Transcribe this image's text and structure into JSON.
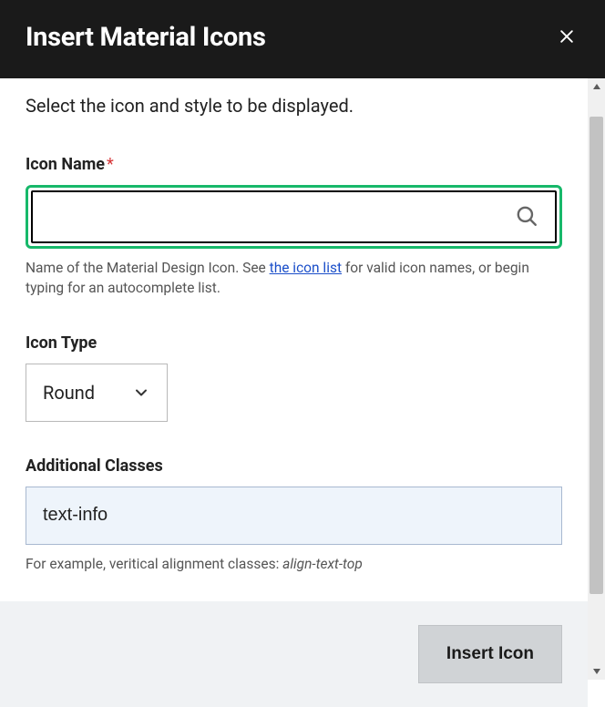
{
  "dialog": {
    "title": "Insert Material Icons",
    "subtitle": "Select the icon and style to be displayed."
  },
  "fields": {
    "iconName": {
      "label": "Icon Name",
      "required": "*",
      "value": "",
      "help_prefix": "Name of the Material Design Icon. See ",
      "help_link": "the icon list",
      "help_suffix": " for valid icon names, or begin typing for an autocomplete list."
    },
    "iconType": {
      "label": "Icon Type",
      "value": "Round"
    },
    "additionalClasses": {
      "label": "Additional Classes",
      "value": "text-info",
      "help_prefix": "For example, veritical alignment classes: ",
      "help_em": "align-text-top"
    }
  },
  "footer": {
    "submit": "Insert Icon"
  }
}
